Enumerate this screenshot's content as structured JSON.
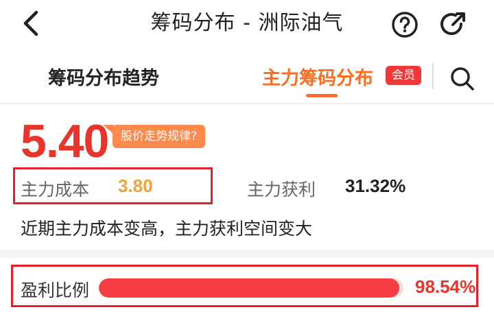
{
  "header": {
    "title": "筹码分布 - 洲际油气",
    "back_icon": "chevron-left-icon",
    "help_icon": "question-circle-icon",
    "share_icon": "share-arrow-icon"
  },
  "tabs": {
    "items": [
      {
        "label": "筹码分布趋势",
        "active": false
      },
      {
        "label": "主力筹码分布",
        "active": true,
        "badge": "会员"
      }
    ],
    "search_icon": "search-icon",
    "active_color": "#ff6d1f"
  },
  "summary": {
    "price": "5.40",
    "price_color": "#e8352c",
    "tooltip": "股价走势规律?",
    "main_cost_label": "主力成本",
    "main_cost_value": "3.80",
    "main_profit_label": "主力获利",
    "main_profit_value": "31.32%",
    "description": "近期主力成本变高，主力获利空间变大"
  },
  "profit_ratio": {
    "label": "盈利比例",
    "value": "98.54%",
    "fraction": 0.9854,
    "bar_color": "#f53d43"
  }
}
